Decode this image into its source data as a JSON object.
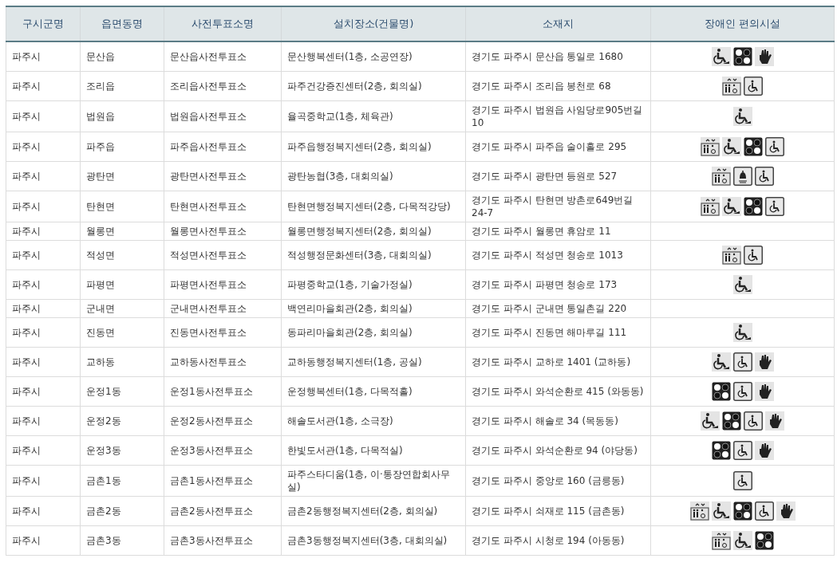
{
  "table": {
    "columns": [
      "구시군명",
      "읍면동명",
      "사전투표소명",
      "설치장소(건물명)",
      "소재지",
      "장애인 편의시설"
    ],
    "rows": [
      {
        "city": "파주시",
        "district": "문산읍",
        "station": "문산읍사전투표소",
        "place": "문산행복센터(1층, 소공연장)",
        "address": "경기도 파주시 문산읍 통일로 1680",
        "facilities": [
          {
            "kind": "ramp"
          },
          {
            "kind": "braille"
          },
          {
            "kind": "sign"
          }
        ]
      },
      {
        "city": "파주시",
        "district": "조리읍",
        "station": "조리읍사전투표소",
        "place": "파주건강증진센터(2층, 회의실)",
        "address": "경기도 파주시 조리읍 봉천로 68",
        "facilities": [
          {
            "kind": "elevator"
          },
          {
            "kind": "wheelchair"
          }
        ]
      },
      {
        "city": "파주시",
        "district": "법원읍",
        "station": "법원읍사전투표소",
        "place": "율곡중학교(1층, 체육관)",
        "address": "경기도 파주시 법원읍 사임당로905번길 10",
        "facilities": [
          {
            "kind": "ramp"
          }
        ]
      },
      {
        "city": "파주시",
        "district": "파주읍",
        "station": "파주읍사전투표소",
        "place": "파주읍행정복지센터(2층, 회의실)",
        "address": "경기도 파주시 파주읍 술이홀로 295",
        "facilities": [
          {
            "kind": "elevator"
          },
          {
            "kind": "ramp"
          },
          {
            "kind": "braille"
          },
          {
            "kind": "wheelchair"
          }
        ]
      },
      {
        "city": "파주시",
        "district": "광탄면",
        "station": "광탄면사전투표소",
        "place": "광탄농협(3층, 대회의실)",
        "address": "경기도 파주시 광탄면 등원로 527",
        "facilities": [
          {
            "kind": "elevator"
          },
          {
            "kind": "bell"
          },
          {
            "kind": "wheelchair"
          }
        ]
      },
      {
        "city": "파주시",
        "district": "탄현면",
        "station": "탄현면사전투표소",
        "place": "탄현면행정복지센터(2층, 다목적강당)",
        "address": "경기도 파주시 탄현면 방촌로649번길 24-7",
        "facilities": [
          {
            "kind": "elevator"
          },
          {
            "kind": "ramp"
          },
          {
            "kind": "braille"
          },
          {
            "kind": "wheelchair"
          }
        ]
      },
      {
        "city": "파주시",
        "district": "월롱면",
        "station": "월롱면사전투표소",
        "place": "월롱면행정복지센터(2층, 회의실)",
        "address": "경기도 파주시 월롱면 휴암로 11",
        "facilities": []
      },
      {
        "city": "파주시",
        "district": "적성면",
        "station": "적성면사전투표소",
        "place": "적성행정문화센터(3층, 대회의실)",
        "address": "경기도 파주시 적성면 청송로 1013",
        "facilities": [
          {
            "kind": "elevator"
          },
          {
            "kind": "wheelchair"
          }
        ]
      },
      {
        "city": "파주시",
        "district": "파평면",
        "station": "파평면사전투표소",
        "place": "파평중학교(1층, 기술가정실)",
        "address": "경기도 파주시 파평면 청송로 173",
        "facilities": [
          {
            "kind": "ramp"
          }
        ]
      },
      {
        "city": "파주시",
        "district": "군내면",
        "station": "군내면사전투표소",
        "place": "백연리마을회관(2층, 회의실)",
        "address": "경기도 파주시 군내면 통일촌길 220",
        "facilities": []
      },
      {
        "city": "파주시",
        "district": "진동면",
        "station": "진동면사전투표소",
        "place": "동파리마을회관(2층, 회의실)",
        "address": "경기도 파주시 진동면 해마루길 111",
        "facilities": [
          {
            "kind": "ramp"
          }
        ]
      },
      {
        "city": "파주시",
        "district": "교하동",
        "station": "교하동사전투표소",
        "place": "교하동행정복지센터(1층, 공실)",
        "address": "경기도 파주시 교하로 1401 (교하동)",
        "facilities": [
          {
            "kind": "ramp"
          },
          {
            "kind": "wheelchair"
          },
          {
            "kind": "sign"
          }
        ]
      },
      {
        "city": "파주시",
        "district": "운정1동",
        "station": "운정1동사전투표소",
        "place": "운정행복센터(1층, 다목적홀)",
        "address": "경기도 파주시 와석순환로 415 (와동동)",
        "facilities": [
          {
            "kind": "braille"
          },
          {
            "kind": "wheelchair"
          },
          {
            "kind": "sign"
          }
        ]
      },
      {
        "city": "파주시",
        "district": "운정2동",
        "station": "운정2동사전투표소",
        "place": "해솔도서관(1층, 소극장)",
        "address": "경기도 파주시 해솔로 34 (목동동)",
        "facilities": [
          {
            "kind": "ramp"
          },
          {
            "kind": "braille"
          },
          {
            "kind": "wheelchair"
          },
          {
            "kind": "sign"
          }
        ]
      },
      {
        "city": "파주시",
        "district": "운정3동",
        "station": "운정3동사전투표소",
        "place": "한빛도서관(1층, 다목적실)",
        "address": "경기도 파주시 와석순환로 94 (야당동)",
        "facilities": [
          {
            "kind": "braille"
          },
          {
            "kind": "wheelchair"
          },
          {
            "kind": "sign"
          }
        ]
      },
      {
        "city": "파주시",
        "district": "금촌1동",
        "station": "금촌1동사전투표소",
        "place": "파주스타디움(1층, 이·통장연합회사무실)",
        "address": "경기도 파주시 중앙로 160 (금릉동)",
        "facilities": [
          {
            "kind": "wheelchair"
          }
        ]
      },
      {
        "city": "파주시",
        "district": "금촌2동",
        "station": "금촌2동사전투표소",
        "place": "금촌2동행정복지센터(2층, 회의실)",
        "address": "경기도 파주시 쇠재로 115 (금촌동)",
        "facilities": [
          {
            "kind": "elevator"
          },
          {
            "kind": "ramp"
          },
          {
            "kind": "braille"
          },
          {
            "kind": "wheelchair"
          },
          {
            "kind": "sign"
          }
        ]
      },
      {
        "city": "파주시",
        "district": "금촌3동",
        "station": "금촌3동사전투표소",
        "place": "금촌3동행정복지센터(3층, 대회의실)",
        "address": "경기도 파주시 시청로 194 (아동동)",
        "facilities": [
          {
            "kind": "elevator"
          },
          {
            "kind": "ramp"
          },
          {
            "kind": "braille"
          }
        ]
      }
    ]
  }
}
